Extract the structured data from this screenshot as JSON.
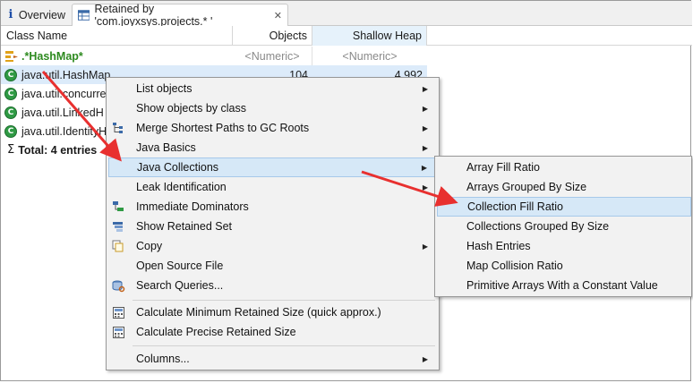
{
  "tabs": [
    {
      "label": "Overview",
      "icon": "info-icon",
      "active": false
    },
    {
      "label": "Retained by 'com.joyxsys.projects.* '",
      "icon": "table-icon",
      "active": true,
      "closable": true
    }
  ],
  "table": {
    "columns": [
      "Class Name",
      "Objects",
      "Shallow Heap"
    ],
    "filter": {
      "name": ".*HashMap*",
      "objects": "<Numeric>",
      "shallow_heap": "<Numeric>"
    },
    "rows": [
      {
        "name": "java.util.HashMap",
        "objects": "104",
        "shallow_heap": "4,992",
        "icon": "class-icon",
        "selected": true
      },
      {
        "name": "java.util.concurre",
        "objects": "",
        "shallow_heap": "",
        "icon": "class-icon"
      },
      {
        "name": "java.util.LinkedH",
        "objects": "",
        "shallow_heap": "",
        "icon": "class-icon"
      },
      {
        "name": "java.util.IdentityH",
        "objects": "",
        "shallow_heap": "",
        "icon": "class-icon"
      }
    ],
    "total": "Total: 4 entries"
  },
  "context_menu": {
    "items": [
      {
        "label": "List objects",
        "submenu": true
      },
      {
        "label": "Show objects by class",
        "submenu": true
      },
      {
        "label": "Merge Shortest Paths to GC Roots",
        "submenu": true,
        "icon": "merge-paths-icon"
      },
      {
        "label": "Java Basics",
        "submenu": true
      },
      {
        "label": "Java Collections",
        "submenu": true,
        "highlighted": true
      },
      {
        "label": "Leak Identification",
        "submenu": true
      },
      {
        "label": "Immediate Dominators",
        "icon": "dominators-icon"
      },
      {
        "label": "Show Retained Set",
        "icon": "retained-set-icon"
      },
      {
        "label": "Copy",
        "submenu": true,
        "icon": "copy-icon"
      },
      {
        "label": "Open Source File"
      },
      {
        "label": "Search Queries...",
        "icon": "search-queries-icon"
      },
      {
        "label": "Calculate Minimum Retained Size (quick approx.)",
        "icon": "calculator-icon"
      },
      {
        "label": "Calculate Precise Retained Size",
        "icon": "calculator-icon"
      },
      {
        "label": "Columns...",
        "submenu": true
      }
    ]
  },
  "submenu": {
    "items": [
      {
        "label": "Array Fill Ratio"
      },
      {
        "label": "Arrays Grouped By Size"
      },
      {
        "label": "Collection Fill Ratio",
        "highlighted": true
      },
      {
        "label": "Collections Grouped By Size"
      },
      {
        "label": "Hash Entries"
      },
      {
        "label": "Map Collision Ratio"
      },
      {
        "label": "Primitive Arrays With a Constant Value"
      }
    ]
  },
  "colors": {
    "annotation_arrow": "#e8302f",
    "menu_highlight": "#d6e8f7",
    "selected_row": "#dcebfa",
    "header_sorted": "#e6f2fb",
    "class_icon": "#2f9a44",
    "regex_text": "#2d8a1f"
  }
}
